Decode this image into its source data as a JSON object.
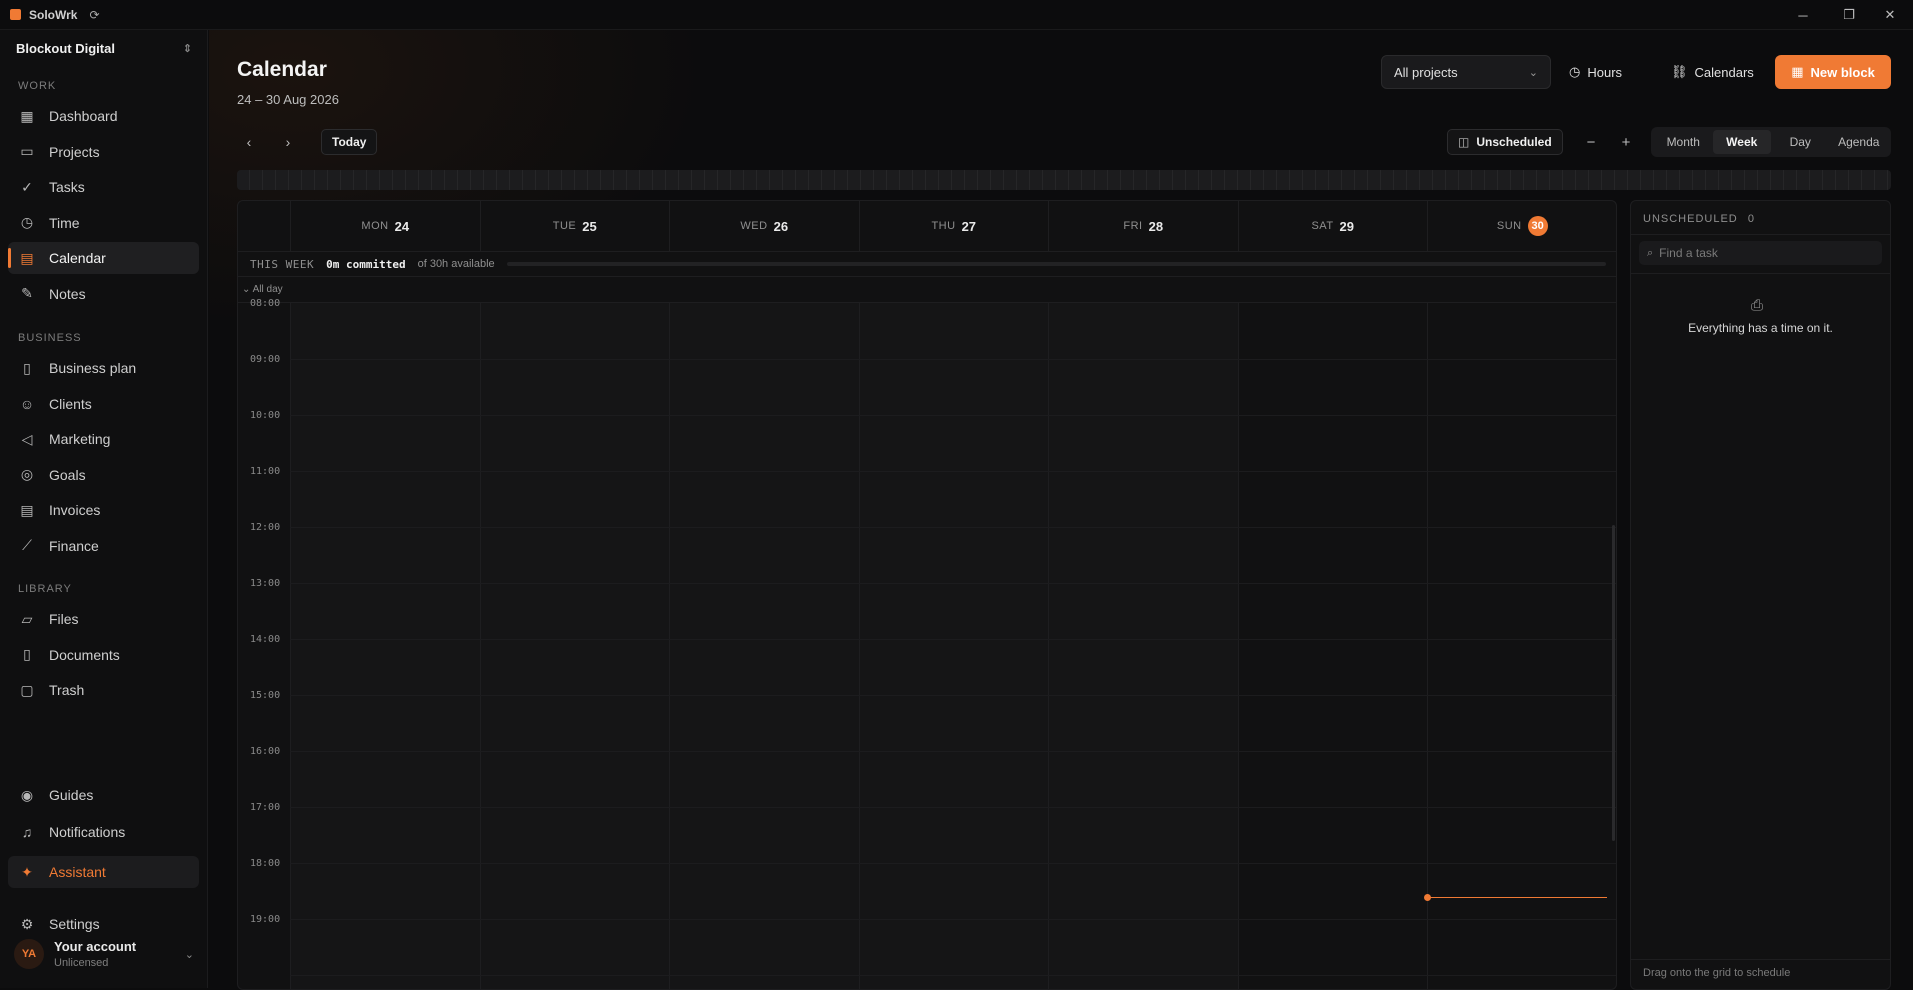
{
  "window": {
    "title": "SoloWrk",
    "minimize": "─",
    "restore": "❐",
    "close": "✕"
  },
  "sidebar": {
    "workspace": "Blockout Digital",
    "sections": {
      "work": "WORK",
      "business": "BUSINESS",
      "library": "LIBRARY"
    },
    "work_items": [
      {
        "label": "Dashboard",
        "icon": "dashboard-icon"
      },
      {
        "label": "Projects",
        "icon": "folder-icon"
      },
      {
        "label": "Tasks",
        "icon": "check-circle-icon"
      },
      {
        "label": "Time",
        "icon": "clock-icon"
      },
      {
        "label": "Calendar",
        "icon": "calendar-icon",
        "active": true
      },
      {
        "label": "Notes",
        "icon": "note-icon"
      }
    ],
    "business_items": [
      {
        "label": "Business plan",
        "icon": "book-icon"
      },
      {
        "label": "Clients",
        "icon": "users-icon"
      },
      {
        "label": "Marketing",
        "icon": "megaphone-icon"
      },
      {
        "label": "Goals",
        "icon": "target-icon"
      },
      {
        "label": "Invoices",
        "icon": "invoice-icon"
      },
      {
        "label": "Finance",
        "icon": "chart-icon"
      }
    ],
    "library_items": [
      {
        "label": "Files",
        "icon": "folder-open-icon"
      },
      {
        "label": "Documents",
        "icon": "document-icon"
      },
      {
        "label": "Trash",
        "icon": "trash-icon"
      }
    ],
    "bottom_items": [
      {
        "label": "Guides",
        "icon": "lifebuoy-icon"
      },
      {
        "label": "Notifications",
        "icon": "bell-icon"
      },
      {
        "label": "Assistant",
        "icon": "sparkle-icon"
      },
      {
        "label": "Settings",
        "icon": "gear-icon"
      }
    ],
    "account": {
      "initials": "YA",
      "name": "Your account",
      "status": "Unlicensed"
    }
  },
  "header": {
    "title": "Calendar",
    "date_range": "24 – 30 Aug 2026",
    "project_filter": "All projects",
    "hours_label": "Hours",
    "calendars_label": "Calendars",
    "new_block_label": "New block"
  },
  "toolbar": {
    "today_label": "Today",
    "unscheduled_label": "Unscheduled",
    "zoom_out": "−",
    "zoom_in": "+",
    "views": [
      "Month",
      "Week",
      "Day",
      "Agenda"
    ],
    "active_view": "Week"
  },
  "week": {
    "days": [
      {
        "name": "MON",
        "date": "24"
      },
      {
        "name": "TUE",
        "date": "25"
      },
      {
        "name": "WED",
        "date": "26"
      },
      {
        "name": "THU",
        "date": "27"
      },
      {
        "name": "FRI",
        "date": "28"
      },
      {
        "name": "SAT",
        "date": "29"
      },
      {
        "name": "SUN",
        "date": "30",
        "today": true
      }
    ],
    "this_week_label": "THIS WEEK",
    "committed": "0m committed",
    "available": "of 30h available",
    "all_day_label": "All day",
    "hours": [
      "08:00",
      "09:00",
      "10:00",
      "11:00",
      "12:00",
      "13:00",
      "14:00",
      "15:00",
      "16:00",
      "17:00",
      "18:00",
      "19:00"
    ]
  },
  "unscheduled": {
    "title": "UNSCHEDULED",
    "count": "0",
    "search_placeholder": "Find a task",
    "empty_message": "Everything has a time on it.",
    "footer_hint": "Drag onto the grid to schedule"
  },
  "colors": {
    "accent": "#f07a34",
    "background": "#0c0c0d",
    "panel": "#111112"
  }
}
